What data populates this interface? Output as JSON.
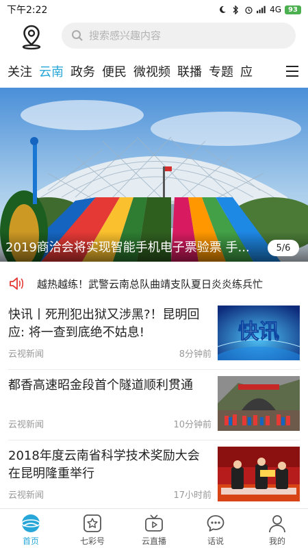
{
  "status_bar": {
    "time": "下午2:22",
    "network": "4G",
    "battery": "93"
  },
  "search": {
    "placeholder": "搜索感兴趣内容",
    "icon": "search-icon"
  },
  "location": {
    "icon": "location-pin-icon"
  },
  "tabs": [
    {
      "label": "关注",
      "active": false
    },
    {
      "label": "云南",
      "active": true
    },
    {
      "label": "政务",
      "active": false
    },
    {
      "label": "便民",
      "active": false
    },
    {
      "label": "微视频",
      "active": false
    },
    {
      "label": "联播",
      "active": false
    },
    {
      "label": "专题",
      "active": false
    },
    {
      "label": "应",
      "active": false
    }
  ],
  "banner": {
    "title": "2019商洽会将实现智能手机电子票验票 手...",
    "page": "5/6"
  },
  "ticker": {
    "icon": "speaker-icon",
    "text": "越热越练！武警云南总队曲靖支队夏日炎炎练兵忙"
  },
  "news": [
    {
      "title": "快讯丨死刑犯出狱又涉黑?！昆明回应: 将一查到底绝不姑息!",
      "source": "云视新闻",
      "time": "8分钟前",
      "thumb_text": "快讯"
    },
    {
      "title": "都香高速昭金段首个隧道顺利贯通",
      "source": "云视新闻",
      "time": "10分钟前",
      "thumb_text": ""
    },
    {
      "title": "2018年度云南省科学技术奖励大会在昆明隆重举行",
      "source": "云视新闻",
      "time": "17小时前",
      "thumb_text": ""
    }
  ],
  "bottom_nav": [
    {
      "label": "首页",
      "icon": "home-globe-icon",
      "active": true
    },
    {
      "label": "七彩号",
      "icon": "star-icon",
      "active": false
    },
    {
      "label": "云直播",
      "icon": "tv-play-icon",
      "active": false
    },
    {
      "label": "话说",
      "icon": "chat-bubble-icon",
      "active": false
    },
    {
      "label": "我的",
      "icon": "user-icon",
      "active": false
    }
  ],
  "colors": {
    "accent": "#27a7d8",
    "ticker_red": "#e53935",
    "battery_green": "#4caf50"
  }
}
